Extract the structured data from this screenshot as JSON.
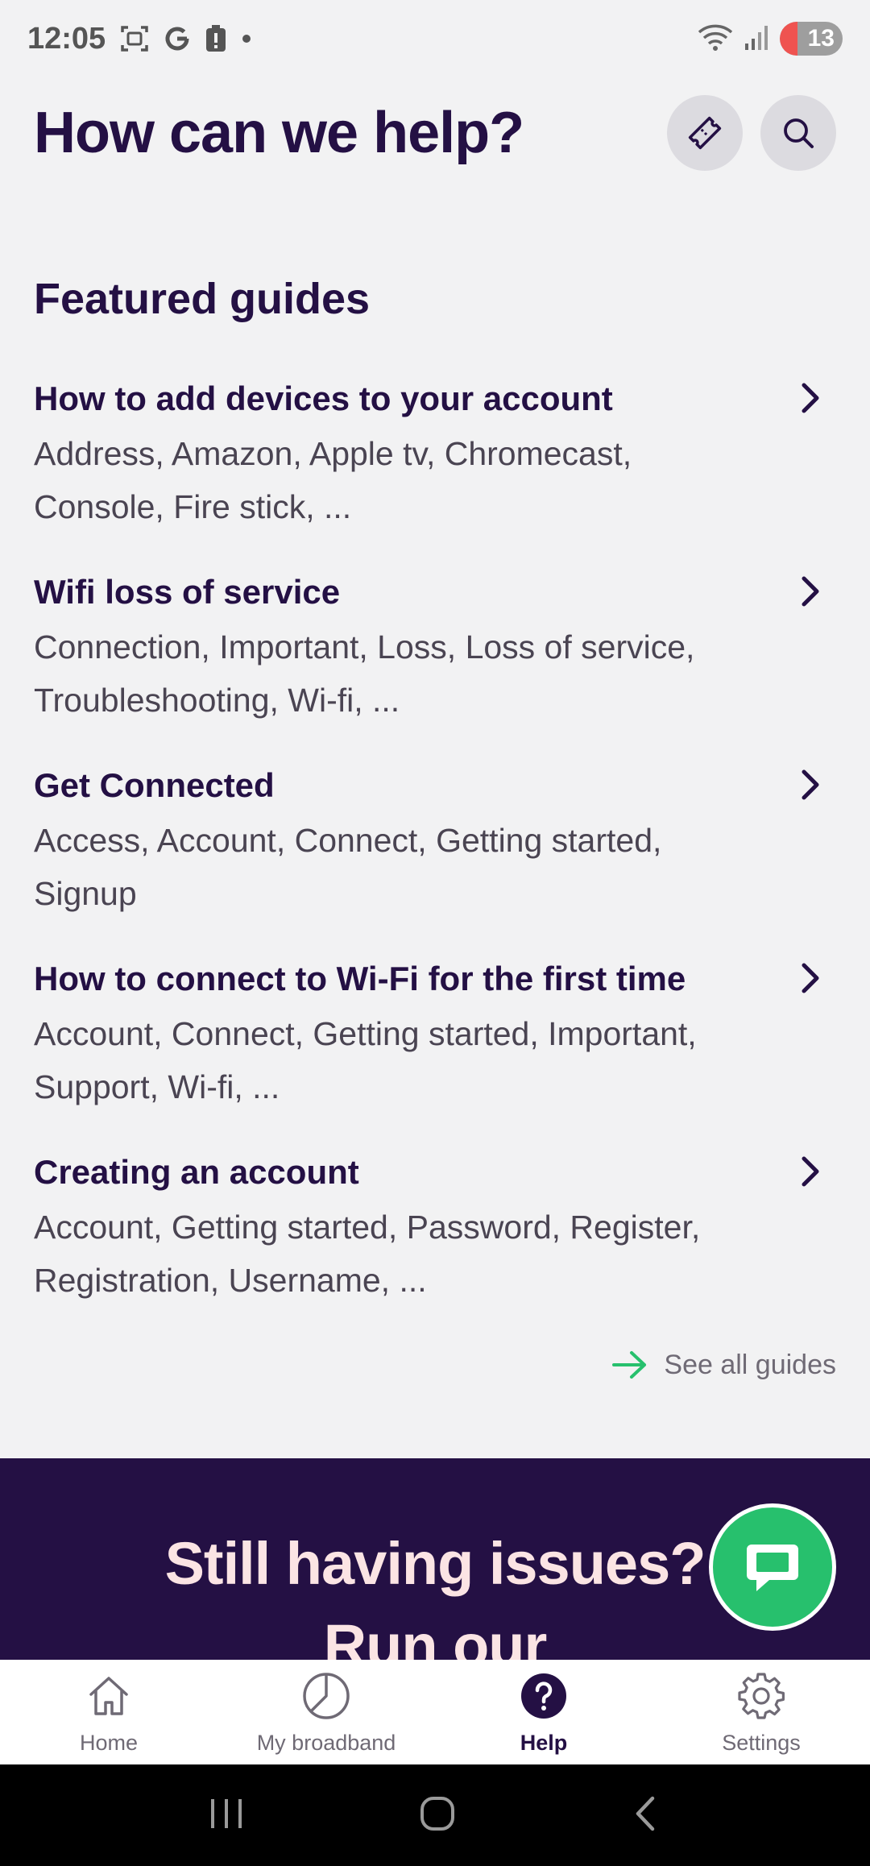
{
  "status_bar": {
    "time": "12:05",
    "icons_left": [
      "screenshot-icon",
      "google-icon",
      "alert-icon",
      "dot-icon"
    ],
    "icons_right": [
      "wifi-icon",
      "signal-icon"
    ],
    "battery": "13"
  },
  "header": {
    "title": "How can we help?",
    "ticket_icon": "ticket-icon",
    "search_icon": "search-icon"
  },
  "featured": {
    "title": "Featured guides",
    "guides": [
      {
        "title": "How to add devices to your account",
        "tags_line1": "Address, Amazon, Apple tv, Chromecast,",
        "tags_line2": "Console, Fire stick, ..."
      },
      {
        "title": "Wifi loss of service",
        "tags_line1": "Connection, Important, Loss, Loss of service,",
        "tags_line2": "Troubleshooting, Wi-fi, ..."
      },
      {
        "title": "Get Connected",
        "tags_line1": "Access, Account, Connect, Getting started,",
        "tags_line2": "Signup"
      },
      {
        "title": "How to connect to Wi-Fi for the first time",
        "tags_line1": "Account, Connect, Getting started, Important,",
        "tags_line2": "Support, Wi-fi, ..."
      },
      {
        "title": "Creating an account",
        "tags_line1": "Account, Getting started, Password, Register,",
        "tags_line2": "Registration, Username, ..."
      }
    ],
    "see_all": "See all guides"
  },
  "banner": {
    "line1": "Still having issues?",
    "line2": "Run our"
  },
  "bottom_nav": {
    "items": [
      {
        "label": "Home",
        "icon": "home-icon"
      },
      {
        "label": "My broadband",
        "icon": "pie-chart-icon"
      },
      {
        "label": "Help",
        "icon": "help-icon"
      },
      {
        "label": "Settings",
        "icon": "gear-icon"
      }
    ],
    "active": "Help"
  },
  "colors": {
    "brand_dark": "#241044",
    "accent_green": "#27c06d",
    "background": "#f2f2f3",
    "banner_text": "#fbe4e4"
  }
}
